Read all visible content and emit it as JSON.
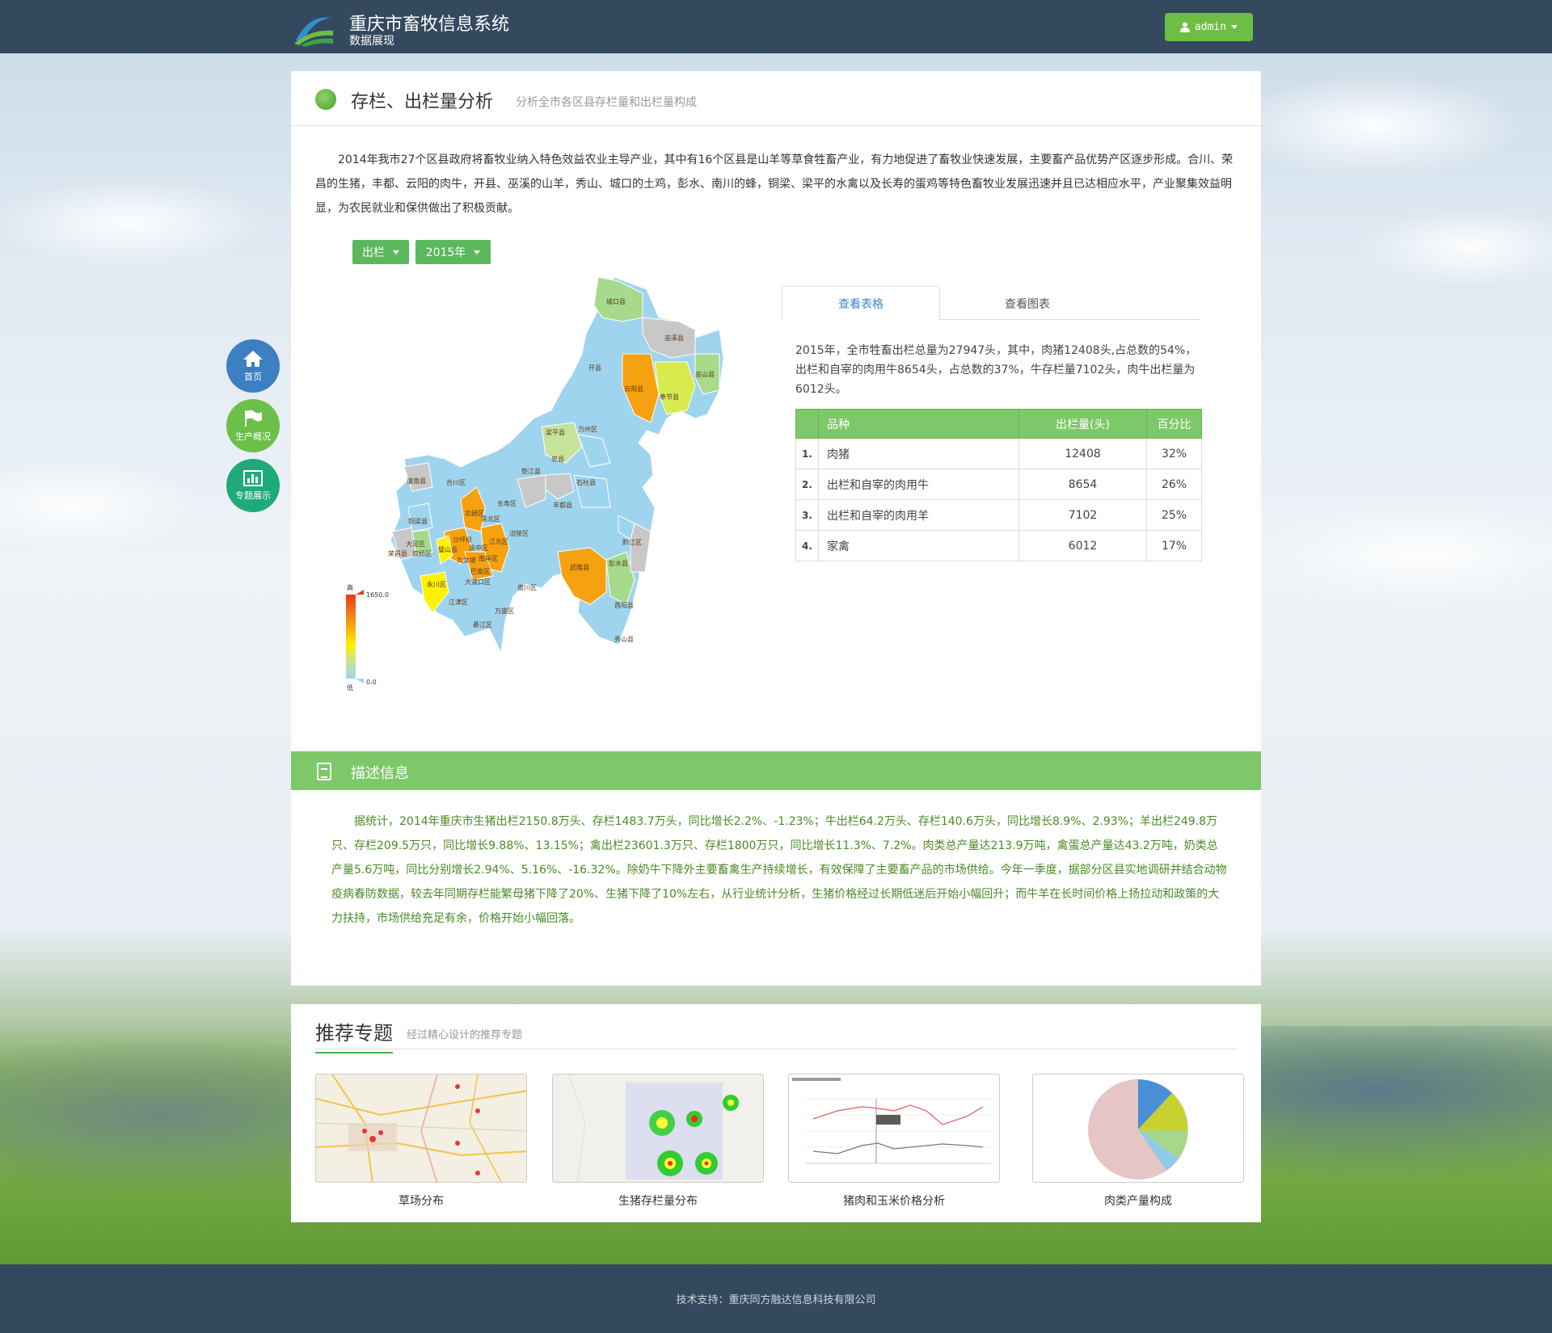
{
  "header": {
    "title": "重庆市畜牧信息系统",
    "subtitle": "数据展现",
    "user": "admin"
  },
  "side_nav": [
    {
      "label": "首页",
      "icon": "home-icon"
    },
    {
      "label": "生产概况",
      "icon": "flag-icon"
    },
    {
      "label": "专题展示",
      "icon": "bar-chart-icon"
    }
  ],
  "analysis": {
    "title": "存栏、出栏量分析",
    "subtitle": "分析全市各区县存栏量和出栏量构成",
    "intro": "2014年我市27个区县政府将畜牧业纳入特色效益农业主导产业，其中有16个区县是山羊等草食牲畜产业，有力地促进了畜牧业快速发展，主要畜产品优势产区逐步形成。合川、荣昌的生猪，丰都、云阳的肉牛，开县、巫溪的山羊，秀山、城口的土鸡，彭水、南川的蜂，铜梁、梁平的水禽以及长寿的蛋鸡等特色畜牧业发展迅速并且已达相应水平，产业聚集效益明显，为农民就业和保供做出了积极贡献。",
    "filter_type": "出栏",
    "filter_year": "2015年"
  },
  "map": {
    "legend_max": "1650.0",
    "legend_min": "0.0",
    "legend_high": "高",
    "legend_low": "低",
    "labels": [
      "城口县",
      "巫溪县",
      "开县",
      "云阳县",
      "奉节县",
      "巫山县",
      "梁平县",
      "万州区",
      "忠县",
      "石柱县",
      "垫江县",
      "长寿区",
      "丰都县",
      "涪陵区",
      "武隆县",
      "彭水县",
      "黔江区",
      "酉阳县",
      "秀山县",
      "南川区",
      "万盛区",
      "綦江区",
      "江津区",
      "永川区",
      "荣昌县",
      "大足区",
      "双桥区",
      "铜梁县",
      "潼南县",
      "合川区",
      "北碚区",
      "渝北区",
      "江北区",
      "沙坪坝",
      "渝中区",
      "九龙坡",
      "南岸区",
      "巴南区",
      "大渡口区",
      "璧山县"
    ]
  },
  "tabs": {
    "table": "查看表格",
    "chart": "查看图表"
  },
  "summary": "2015年，全市牲畜出栏总量为27947头，其中，肉猪12408头,占总数的54%，出栏和自宰的肉用牛8654头，占总数的37%，牛存栏量7102头，肉牛出栏量为6012头。",
  "table": {
    "columns": [
      "",
      "品种",
      "出栏量(头)",
      "百分比"
    ],
    "rows": [
      {
        "idx": "1.",
        "name": "肉猪",
        "value": "12408",
        "pct": "32%"
      },
      {
        "idx": "2.",
        "name": "出栏和自宰的肉用牛",
        "value": "8654",
        "pct": "26%"
      },
      {
        "idx": "3.",
        "name": "出栏和自宰的肉用羊",
        "value": "7102",
        "pct": "25%"
      },
      {
        "idx": "4.",
        "name": "家禽",
        "value": "6012",
        "pct": "17%"
      }
    ]
  },
  "description": {
    "title": "描述信息",
    "text": "据统计，2014年重庆市生猪出栏2150.8万头、存栏1483.7万头，同比增长2.2%、-1.23%；牛出栏64.2万头、存栏140.6万头，同比增长8.9%、2.93%；羊出栏249.8万只、存栏209.5万只，同比增长9.88%、13.15%；禽出栏23601.3万只、存栏1800万只，同比增长11.3%、7.2%。肉类总产量达213.9万吨，禽蛋总产量达43.2万吨，奶类总产量5.6万吨，同比分别增长2.94%、5.16%、-16.32%。除奶牛下降外主要畜禽生产持续增长，有效保障了主要畜产品的市场供给。今年一季度，据部分区县实地调研并结合动物疫病春防数据，较去年同期存栏能繁母猪下降了20%、生猪下降了10%左右，从行业统计分析，生猪价格经过长期低迷后开始小幅回升；而牛羊在长时间价格上扬拉动和政策的大力扶持，市场供给充足有余，价格开始小幅回落。"
  },
  "recommend": {
    "title": "推荐专题",
    "subtitle": "经过精心设计的推荐专题",
    "cards": [
      {
        "label": "草场分布"
      },
      {
        "label": "生猪存栏量分布"
      },
      {
        "label": "猪肉和玉米价格分析"
      },
      {
        "label": "肉类产量构成"
      }
    ]
  },
  "footer": "技术支持：重庆同方融达信息科技有限公司",
  "colors": {
    "topbar": "#34495e",
    "accent_green": "#7ec86a",
    "button_green": "#5cb85c",
    "home_blue": "#3c7fc2"
  }
}
